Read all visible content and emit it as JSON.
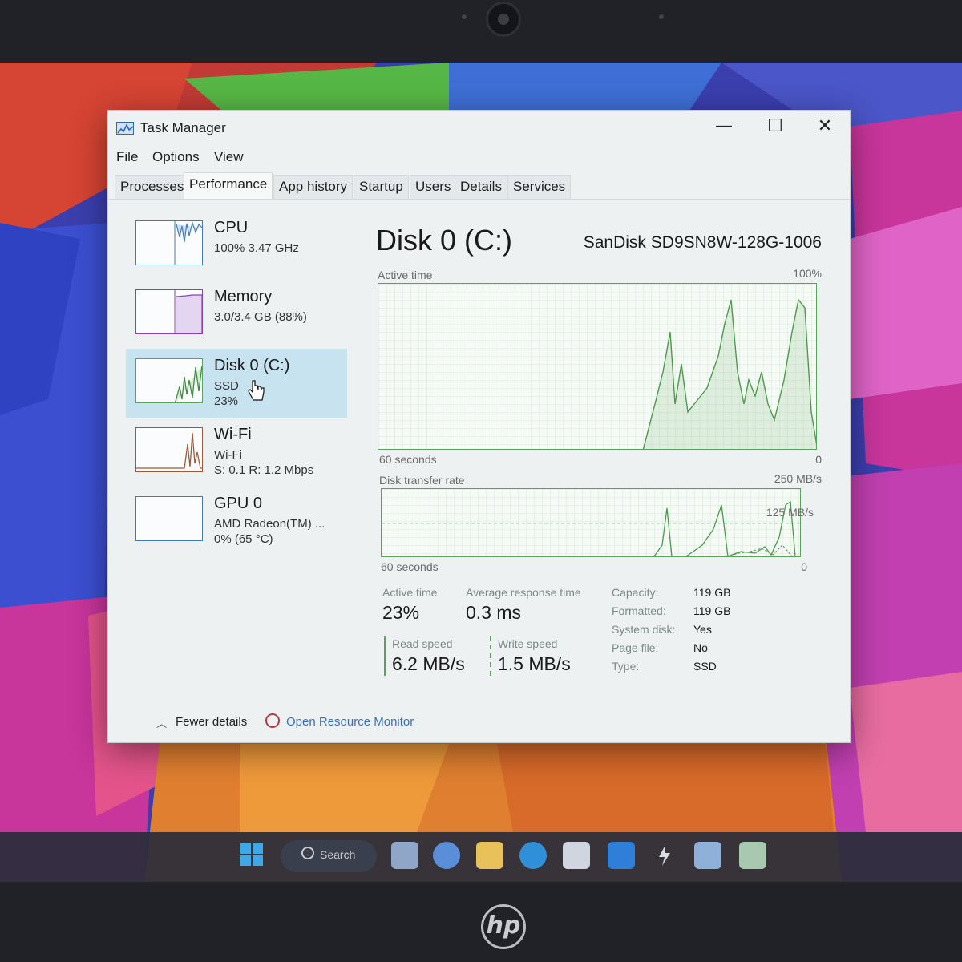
{
  "window": {
    "title": "Task Manager",
    "controls": {
      "minimize": "—",
      "maximize": "☐",
      "close": "✕"
    }
  },
  "menu": [
    "File",
    "Options",
    "View"
  ],
  "tabs": [
    "Processes",
    "Performance",
    "App history",
    "Startup",
    "Users",
    "Details",
    "Services"
  ],
  "active_tab": "Performance",
  "sidebar": [
    {
      "title": "CPU",
      "sub": "100%  3.47 GHz",
      "sub2": ""
    },
    {
      "title": "Memory",
      "sub": "3.0/3.4 GB (88%)",
      "sub2": ""
    },
    {
      "title": "Disk 0 (C:)",
      "sub": "SSD",
      "sub2": "23%"
    },
    {
      "title": "Wi-Fi",
      "sub": "Wi-Fi",
      "sub2": "S: 0.1  R: 1.2 Mbps"
    },
    {
      "title": "GPU 0",
      "sub": "AMD Radeon(TM) ...",
      "sub2": "0%  (65 °C)"
    }
  ],
  "main": {
    "title": "Disk 0 (C:)",
    "device": "SanDisk SD9SN8W-128G-1006",
    "active_time_graph": {
      "label": "Active time",
      "max_label": "100%",
      "time_label": "60 seconds",
      "min_label": "0"
    },
    "transfer_graph": {
      "label": "Disk transfer rate",
      "max_label": "250 MB/s",
      "mid_label": "125 MB/s",
      "time_label": "60 seconds",
      "min_label": "0"
    },
    "stats": {
      "active_time_label": "Active time",
      "active_time_value": "23%",
      "avg_response_label": "Average response time",
      "avg_response_value": "0.3 ms",
      "read_label": "Read speed",
      "read_value": "6.2 MB/s",
      "write_label": "Write speed",
      "write_value": "1.5 MB/s"
    },
    "info": [
      {
        "key": "Capacity:",
        "value": "119 GB"
      },
      {
        "key": "Formatted:",
        "value": "119 GB"
      },
      {
        "key": "System disk:",
        "value": "Yes"
      },
      {
        "key": "Page file:",
        "value": "No"
      },
      {
        "key": "Type:",
        "value": "SSD"
      }
    ]
  },
  "footer": {
    "fewer_details": "Fewer details",
    "resource_monitor": "Open Resource Monitor"
  },
  "taskbar": {
    "search_text": "Search"
  },
  "brand": {
    "logo_text": "hp"
  },
  "colors": {
    "disk_green": "#5aa35a",
    "selected_bg": "#c6e3ef",
    "link_blue": "#3b6fb8"
  }
}
